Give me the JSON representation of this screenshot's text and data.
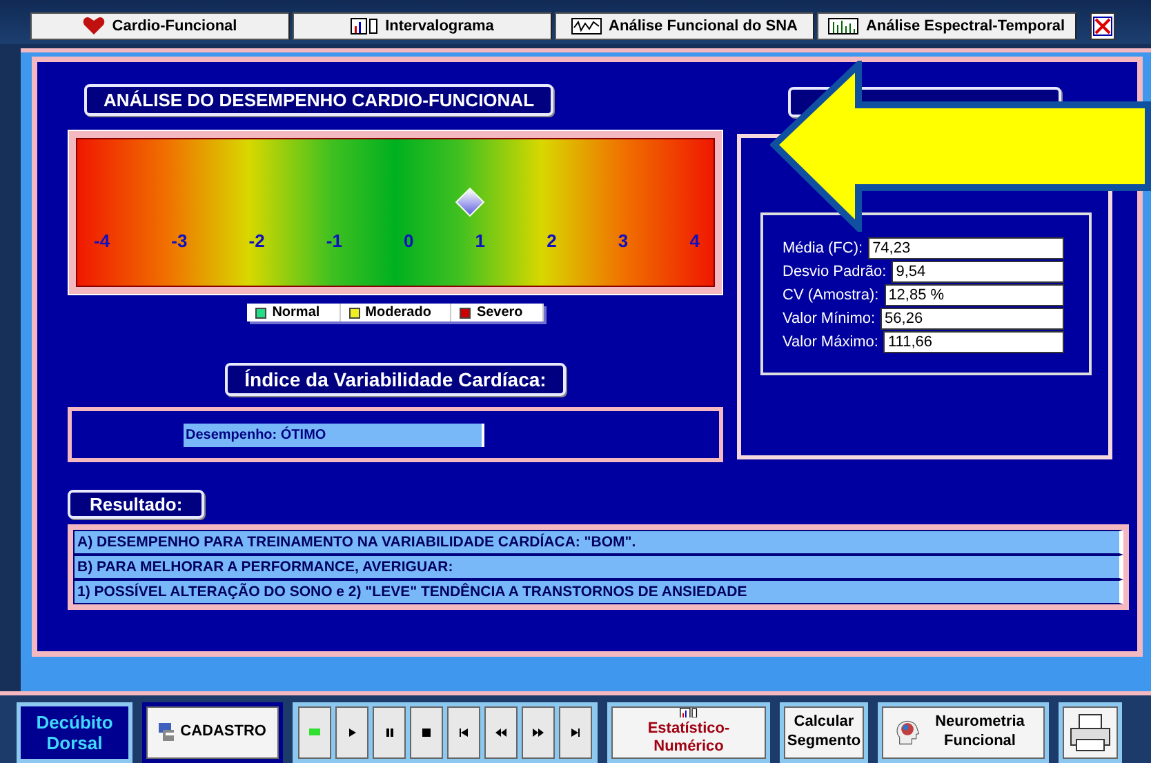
{
  "tabs": [
    {
      "label": "Cardio-Funcional",
      "kind": "heart",
      "selected": false
    },
    {
      "label": "Intervalograma",
      "kind": "bars",
      "selected": false
    },
    {
      "label": "Análise Funcional do SNA",
      "kind": "wave",
      "selected": false
    },
    {
      "label": "Análise Espectral-Temporal",
      "kind": "spectrum",
      "selected": false
    }
  ],
  "performance": {
    "title": "ANÁLISE DO DESEMPENHO CARDIO-FUNCIONAL",
    "ticks": [
      "-4",
      "-3",
      "-2",
      "-1",
      "0",
      "1",
      "2",
      "3",
      "4"
    ],
    "marker": {
      "level": 0.625
    },
    "legend": [
      {
        "label": "Normal",
        "color": "#22dd88"
      },
      {
        "label": "Moderado",
        "color": "#eeee22"
      },
      {
        "label": "Severo",
        "color": "#cc0000"
      }
    ]
  },
  "index": {
    "title": "Índice da Variabilidade Cardíaca:",
    "value": "Desempenho: ÓTIMO"
  },
  "statistics": {
    "rows": [
      {
        "label": "Média (FC):",
        "value": "74,23"
      },
      {
        "label": "Desvio Padrão:",
        "value": "9,54"
      },
      {
        "label": "CV (Amostra):",
        "value": "12,85 %"
      },
      {
        "label": "Valor Mínimo:",
        "value": "56,26"
      },
      {
        "label": "Valor Máximo:",
        "value": "111,66"
      }
    ]
  },
  "result": {
    "title": "Resultado:",
    "lines": [
      "A) DESEMPENHO PARA TREINAMENTO NA VARIABILIDADE CARDÍACA: \"BOM\".",
      "B) PARA MELHORAR A PERFORMANCE, AVERIGUAR:",
      "1) POSSÍVEL ALTERAÇÃO DO SONO e 2) \"LEVE\" TENDÊNCIA A TRANSTORNOS DE ANSIEDADE"
    ]
  },
  "bottom": {
    "position": "Decúbito Dorsal",
    "cadastro": "CADASTRO",
    "media": [
      {
        "kind": "record",
        "active": true
      },
      {
        "kind": "play",
        "active": false
      },
      {
        "kind": "pause",
        "active": false
      },
      {
        "kind": "stop",
        "active": false
      },
      {
        "kind": "first",
        "active": false
      },
      {
        "kind": "rewind",
        "active": false
      },
      {
        "kind": "forward",
        "active": false
      },
      {
        "kind": "last",
        "active": false
      }
    ],
    "statistic": "Estatístico-Numérico",
    "segment": "Calcular Segmento",
    "neuro": "Neurometria Funcional"
  }
}
